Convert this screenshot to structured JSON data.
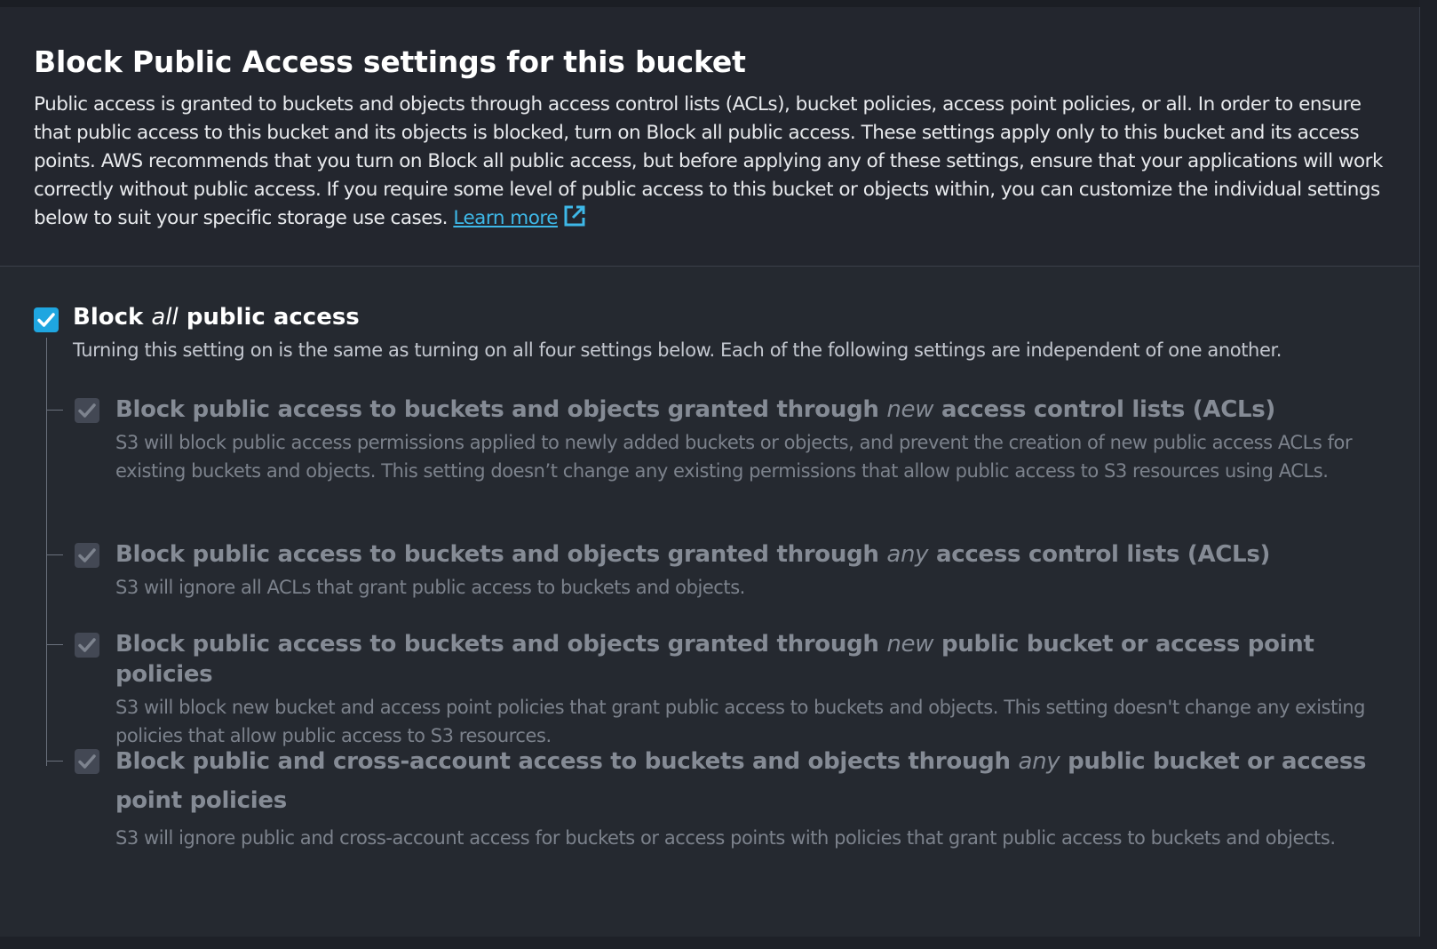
{
  "section": {
    "title": "Block Public Access settings for this bucket",
    "description": "Public access is granted to buckets and objects through access control lists (ACLs), bucket policies, access point policies, or all. In order to ensure that public access to this bucket and its objects is blocked, turn on Block all public access. These settings apply only to this bucket and its access points. AWS recommends that you turn on Block all public access, but before applying any of these settings, ensure that your applications will work correctly without public access. If you require some level of public access to this bucket or objects within, you can customize the individual settings below to suit your specific storage use cases.",
    "learn_more": "Learn more",
    "learn_more_icon": "external-link-icon"
  },
  "block_all": {
    "label_prefix": "Block",
    "label_emphasis": "all",
    "label_suffix": "public access",
    "checked": true,
    "help": "Turning this setting on is the same as turning on all four settings below. Each of the following settings are independent of one another."
  },
  "settings": [
    {
      "label_prefix": "Block public access to buckets and objects granted through",
      "label_emphasis": "new",
      "label_suffix": "access control lists (ACLs)",
      "checked": true,
      "disabled": true,
      "help": "S3 will block public access permissions applied to newly added buckets or objects, and prevent the creation of new public access ACLs for existing buckets and objects. This setting doesn’t change any existing permissions that allow public access to S3 resources using ACLs."
    },
    {
      "label_prefix": "Block public access to buckets and objects granted through",
      "label_emphasis": "any",
      "label_suffix": "access control lists (ACLs)",
      "checked": true,
      "disabled": true,
      "help": "S3 will ignore all ACLs that grant public access to buckets and objects."
    },
    {
      "label_prefix": "Block public access to buckets and objects granted through",
      "label_emphasis": "new",
      "label_suffix": "public bucket or access point policies",
      "checked": true,
      "disabled": true,
      "help": "S3 will block new bucket and access point policies that grant public access to buckets and objects. This setting doesn't change any existing policies that allow public access to S3 resources."
    },
    {
      "label_prefix": "Block public and cross-account access to buckets and objects through",
      "label_emphasis": "any",
      "label_suffix": "public bucket or access point policies",
      "checked": true,
      "disabled": true,
      "help": "S3 will ignore public and cross-account access for buckets or access points with policies that grant public access to buckets and objects."
    }
  ],
  "colors": {
    "accent": "#1fa6e0",
    "link": "#3eb8e8",
    "disabled_text": "#858b95",
    "disabled_checkbox": "#434854"
  }
}
